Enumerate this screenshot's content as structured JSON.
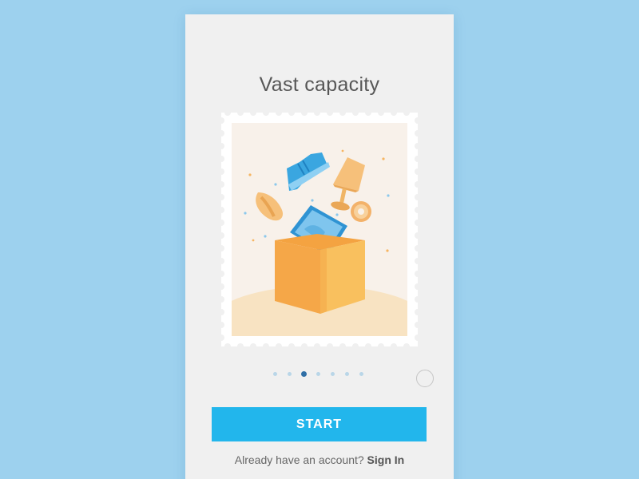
{
  "onboarding": {
    "title": "Vast capacity",
    "illustration": "open box with shoe, lamp, hat, donut and picture popping out",
    "pagination": {
      "count": 7,
      "active_index": 2
    },
    "start_label": "START",
    "account_prompt": "Already have an account?",
    "signin_label": "Sign In"
  },
  "colors": {
    "background": "#9dd1ee",
    "card": "#f0f0f0",
    "button": "#22b6ec",
    "active_dot": "#2f6fa6",
    "inactive_dot": "#b9d6e8"
  }
}
